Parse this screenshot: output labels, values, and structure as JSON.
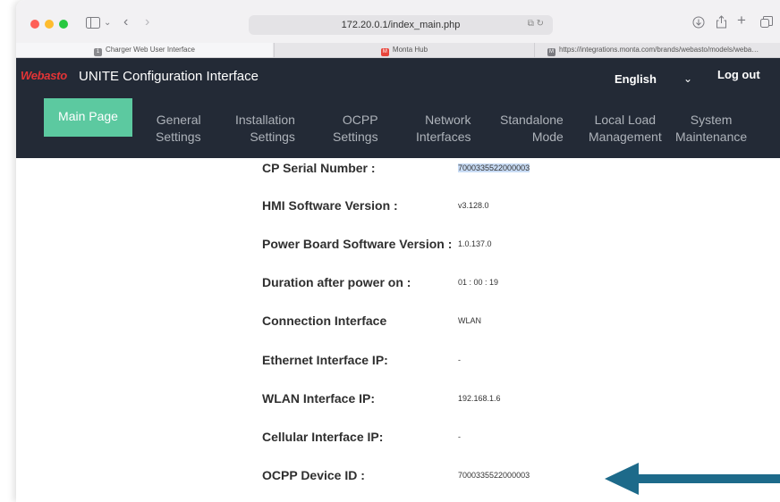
{
  "browser": {
    "url": "172.20.0.1/index_main.php",
    "url_extra": "⧉ ↻",
    "tabs": [
      {
        "label": "Charger Web User Interface",
        "favicon": "1",
        "active": true
      },
      {
        "label": "Monta Hub",
        "favicon": "M",
        "active": false
      },
      {
        "label": "https://integrations.monta.com/brands/webasto/models/weba…",
        "favicon": "M",
        "active": false
      }
    ]
  },
  "app": {
    "logo": "Webasto",
    "title": "UNITE Configuration Interface",
    "language": "English",
    "logout": "Log out",
    "accent": "#5cc9a0",
    "nav": [
      {
        "label": "Main Page"
      },
      {
        "line1": "General",
        "line2": "Settings"
      },
      {
        "line1": "Installation",
        "line2": "Settings"
      },
      {
        "line1": "OCPP",
        "line2": "Settings"
      },
      {
        "line1": "Network",
        "line2": "Interfaces"
      },
      {
        "line1": "Standalone",
        "line2": "Mode"
      },
      {
        "line1": "Local Load",
        "line2": "Management"
      },
      {
        "line1": "System",
        "line2": "Maintenance"
      }
    ]
  },
  "info": {
    "rows": [
      {
        "label": "CP Serial Number :",
        "value": "7000335522000003"
      },
      {
        "label": "HMI Software Version :",
        "value": "v3.128.0"
      },
      {
        "label": "Power Board Software Version :",
        "value": "1.0.137.0"
      },
      {
        "label": "Duration after power on :",
        "value": "01 : 00 : 19"
      },
      {
        "label": "Connection Interface",
        "value": "WLAN"
      },
      {
        "label": "Ethernet Interface IP:",
        "value": "-"
      },
      {
        "label": "WLAN Interface IP:",
        "value": "192.168.1.6"
      },
      {
        "label": "Cellular Interface IP:",
        "value": "-"
      },
      {
        "label": "OCPP Device ID :",
        "value": "7000335522000003"
      }
    ]
  },
  "annotation": {
    "arrow_color": "#1d6a8a",
    "icon": "arrow-left-icon"
  }
}
